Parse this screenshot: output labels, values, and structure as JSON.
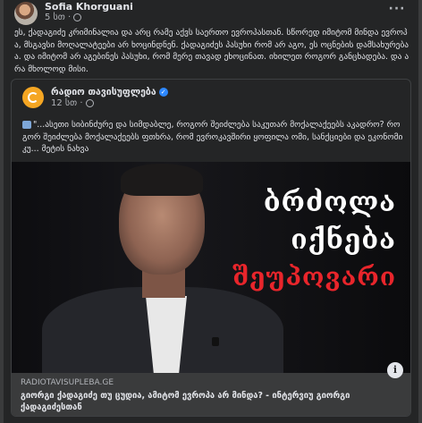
{
  "post": {
    "author": "Sofia Khorguani",
    "time": "5 სთ ·",
    "more_label": "···",
    "text": "ეს, ქადაგიძე კრიმინალია და არც რამე აქვს საერთო ევროპასთან. სწორედ იმიტომ მინდა ევროპა, მსგავსი მოღალატეები არ ხოცინდნენ. ქადაგიძეს პასუხი რომ არ აგო, ეს ოცნების დამსახურებაა. და იმიტომ არ აგებინეს პასუხი, რომ მერე თავად ეხოცინათ. იხილეთ როგორ განცხადება. და არა მხოლოდ მისი."
  },
  "shared": {
    "page_name": "რადიო თავისუფლება",
    "verified_icon": "verified-badge-icon",
    "time": "12 სთ ·",
    "text": "\"...ასეთი სიბინძურე და სიმდაბლე, როგორ შეიძლება საკუთარ მოქალაქეებს აკადრო? როგორ შეიძლება მოქალაქეებს ფთხრა, რომ ევროკავშირი ყოფილა ომი, სანქციები და ეკონომიკუ... მეტის ნახვა",
    "overlay": {
      "line1": "ბრძოლა",
      "line2": "იქნება",
      "line3": "შეუპოვარი",
      "line3_color": "#e8252b"
    },
    "link": {
      "domain": "RADIOTAVISUPLEBA.GE",
      "title": "გიორგი ქადაგიძე თუ ცუდია, ამიტომ ევროპა არ მინდა? - ინტერვიუ გიორგი ქადაგიძესთან"
    }
  },
  "colors": {
    "background": "#242526",
    "text": "#e4e6eb",
    "muted": "#b0b3b8",
    "accent_red": "#e8252b",
    "brand_orange": "#f5a623"
  }
}
